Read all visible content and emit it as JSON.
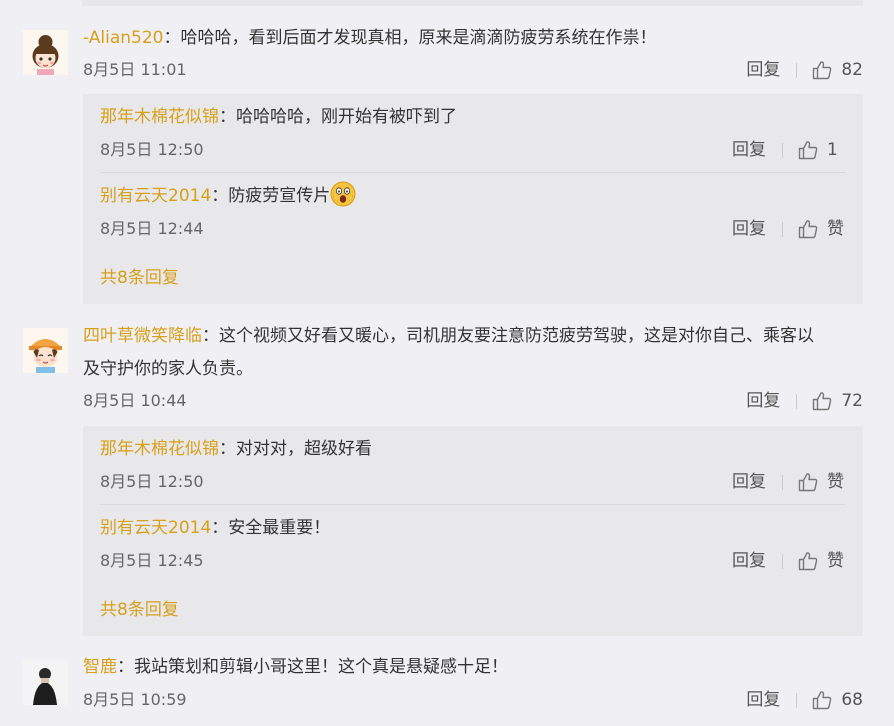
{
  "comments": [
    {
      "user": "-Alian520",
      "sep": "：",
      "text": "哈哈哈，看到后面才发现真相，原来是滴滴防疲劳系统在作祟！",
      "time": "8月5日 11:01",
      "reply_label": "回复",
      "likes": "82",
      "avatar_icon": "cartoon-girl-avatar",
      "replies": [
        {
          "user": "那年木棉花似锦",
          "sep": "：",
          "text": "哈哈哈哈，刚开始有被吓到了",
          "time": "8月5日 12:50",
          "reply_label": "回复",
          "likes": "1"
        },
        {
          "user": "别有云天2014",
          "sep": "：",
          "text": "防疲劳宣传片",
          "emoji": "scared-face-emoji",
          "time": "8月5日 12:44",
          "reply_label": "回复",
          "likes": "赞"
        }
      ],
      "more": "共8条回复"
    },
    {
      "user": "四叶草微笑降临",
      "sep": "：",
      "text_line1": "这个视频又好看又暖心，司机朋友要注意防范疲劳驾驶，这是对你自己、乘客以",
      "text_line2": "及守护你的家人负责。",
      "time": "8月5日 10:44",
      "reply_label": "回复",
      "likes": "72",
      "avatar_icon": "cartoon-girl-hat-avatar",
      "replies": [
        {
          "user": "那年木棉花似锦",
          "sep": "：",
          "text": "对对对，超级好看",
          "time": "8月5日 12:50",
          "reply_label": "回复",
          "likes": "赞"
        },
        {
          "user": "别有云天2014",
          "sep": "：",
          "text": "安全最重要！",
          "time": "8月5日 12:45",
          "reply_label": "回复",
          "likes": "赞"
        }
      ],
      "more": "共8条回复"
    },
    {
      "user": "智鹿",
      "sep": "：",
      "text": "我站策划和剪辑小哥这里！这个真是悬疑感十足！",
      "time": "8月5日 10:59",
      "reply_label": "回复",
      "likes": "68",
      "avatar_icon": "person-photo-avatar"
    }
  ]
}
